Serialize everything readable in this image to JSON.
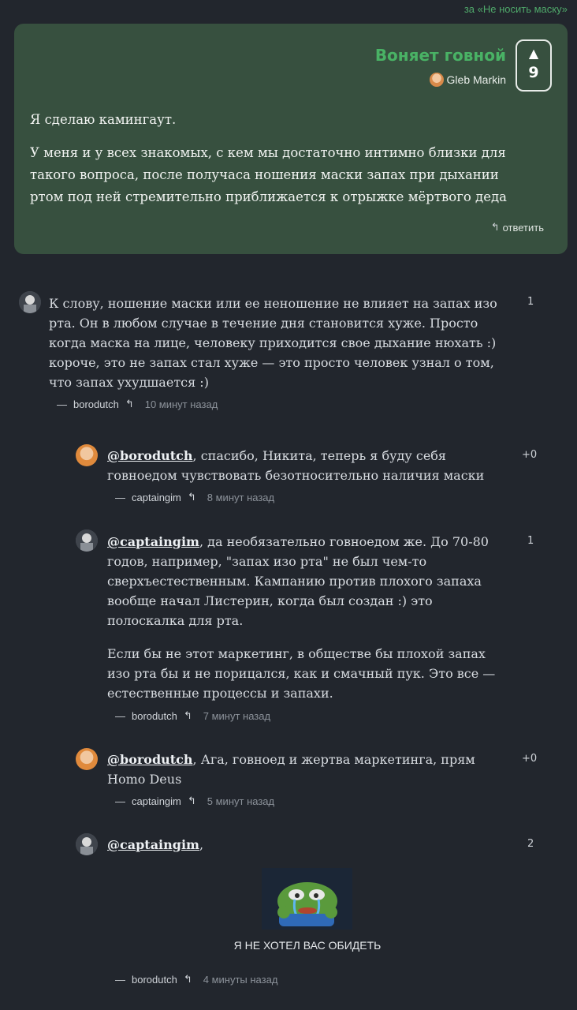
{
  "top_link": "за «Не носить маску»",
  "post": {
    "title": "Воняет говной",
    "author": "Gleb Markin",
    "votes": "9",
    "vote_arrow": "▲",
    "paragraphs": [
      "Я сделаю камингаут.",
      "У меня и у всех знакомых, с кем мы достаточно интимно близки для такого вопроса, после получаса ношения маски запах при дыхании ртом под ней стремительно приближается к отрыжке мёртвого деда"
    ],
    "reply_label": "ответить"
  },
  "comments": [
    {
      "author": "borodutch",
      "score": "1",
      "time": "10 минут назад",
      "mention": "",
      "paragraphs": [
        "К слову, ношение маски или ее неношение не влияет на запах изо рта. Он в любом случае в течение дня становится хуже. Просто когда маска на лице, человеку приходится свое дыхание нюхать :) короче, это не запах стал хуже — это просто человек узнал о том, что запах ухудшается :)"
      ]
    },
    {
      "author": "captaingim",
      "score": "+0",
      "time": "8 минут назад",
      "mention": "@borodutch",
      "paragraphs": [
        ", спасибо, Никита, теперь я буду себя говноедом чувствовать безотносительно наличия маски"
      ]
    },
    {
      "author": "borodutch",
      "score": "1",
      "time": "7 минут назад",
      "mention": "@captaingim",
      "paragraphs": [
        ", да необязательно говноедом же. До 70-80 годов, например, \"запах изо рта\" не был чем-то сверхъестественным. Кампанию против плохого запаха вообще начал Листерин, когда был создан :) это полоскалка для рта.",
        "Если бы не этот маркетинг, в обществе бы плохой запах изо рта бы и не порицался, как и смачный пук. Это все — естественные процессы и запахи."
      ]
    },
    {
      "author": "captaingim",
      "score": "+0",
      "time": "5 минут назад",
      "mention": "@borodutch",
      "paragraphs": [
        ", Ага, говноед и жертва маркетинга, прям Homo Deus"
      ]
    },
    {
      "author": "borodutch",
      "score": "2",
      "time": "4 минуты назад",
      "mention": "@captaingim",
      "paragraphs": [
        ","
      ],
      "caption": "Я НЕ ХОТЕЛ ВАС ОБИДЕТЬ"
    }
  ],
  "meta_dash": "—",
  "reply_icon": "reply-arrow-icon",
  "colors": {
    "background": "#22262d",
    "card": "#37503f",
    "accent": "#49b265"
  }
}
